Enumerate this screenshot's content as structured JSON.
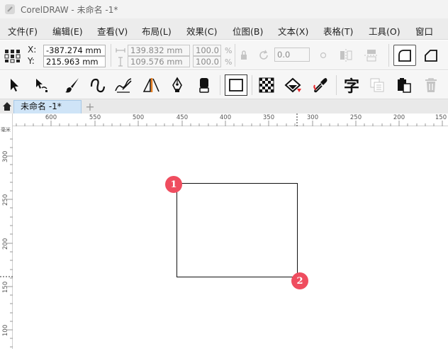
{
  "window": {
    "title": "CorelDRAW - 未命名 -1*"
  },
  "menu": [
    "文件(F)",
    "编辑(E)",
    "查看(V)",
    "布局(L)",
    "效果(C)",
    "位图(B)",
    "文本(X)",
    "表格(T)",
    "工具(O)",
    "窗口"
  ],
  "property_bar": {
    "x_label": "X:",
    "y_label": "Y:",
    "x_value": "-387.274 mm",
    "y_value": "215.963 mm",
    "width_value": "139.832 mm",
    "height_value": "109.576 mm",
    "scale_x": "100.0",
    "scale_y": "100.0",
    "percent": "%",
    "rotation": "0.0"
  },
  "tabs": {
    "document": "未命名 -1*",
    "add": "+"
  },
  "ruler": {
    "horizontal": [
      "600",
      "550",
      "500",
      "450",
      "400",
      "350",
      "300",
      "250",
      "200",
      "150"
    ],
    "vertical": [
      "300",
      "250",
      "200",
      "150",
      "100"
    ],
    "unit": "毫米"
  },
  "annotations": {
    "marker_1": "1",
    "marker_2": "2"
  },
  "colors": {
    "marker": "#ef4d5f",
    "tab_active": "#cfe4f7",
    "pen_accent": "#e67e22"
  }
}
